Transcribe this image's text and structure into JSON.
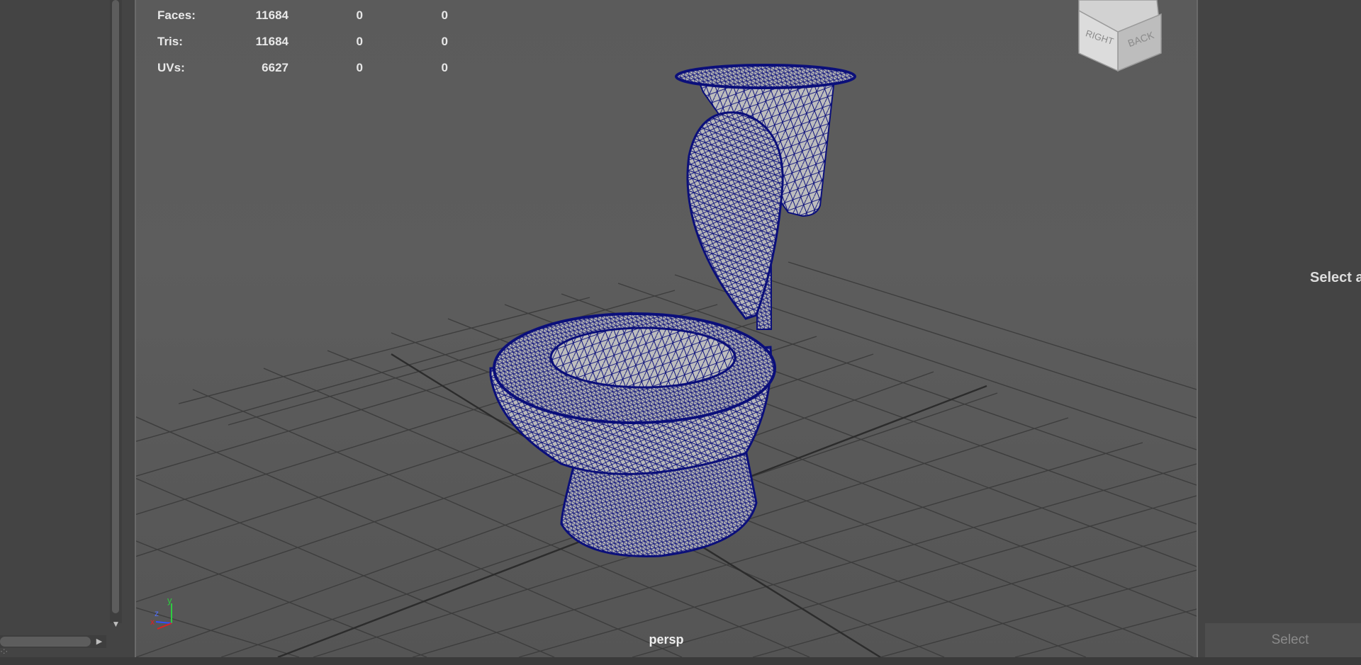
{
  "hud": {
    "rows": [
      {
        "label": "Faces:",
        "v1": "11684",
        "v2": "0",
        "v3": "0"
      },
      {
        "label": "Tris:",
        "v1": "11684",
        "v2": "0",
        "v3": "0"
      },
      {
        "label": "UVs:",
        "v1": "6627",
        "v2": "0",
        "v3": "0"
      }
    ]
  },
  "viewcube": {
    "right_label": "RIGHT",
    "back_label": "BACK"
  },
  "axis": {
    "y": "y",
    "z": "z",
    "x": "x"
  },
  "camera_label": "persp",
  "right_panel": {
    "message": "Select a",
    "button": "Select"
  },
  "colors": {
    "wireframe": "#0b0f7a",
    "mesh_fill": "#b9b9b9",
    "grid": "#3a3a3a",
    "viewport_bg": "#5b5b5b"
  }
}
